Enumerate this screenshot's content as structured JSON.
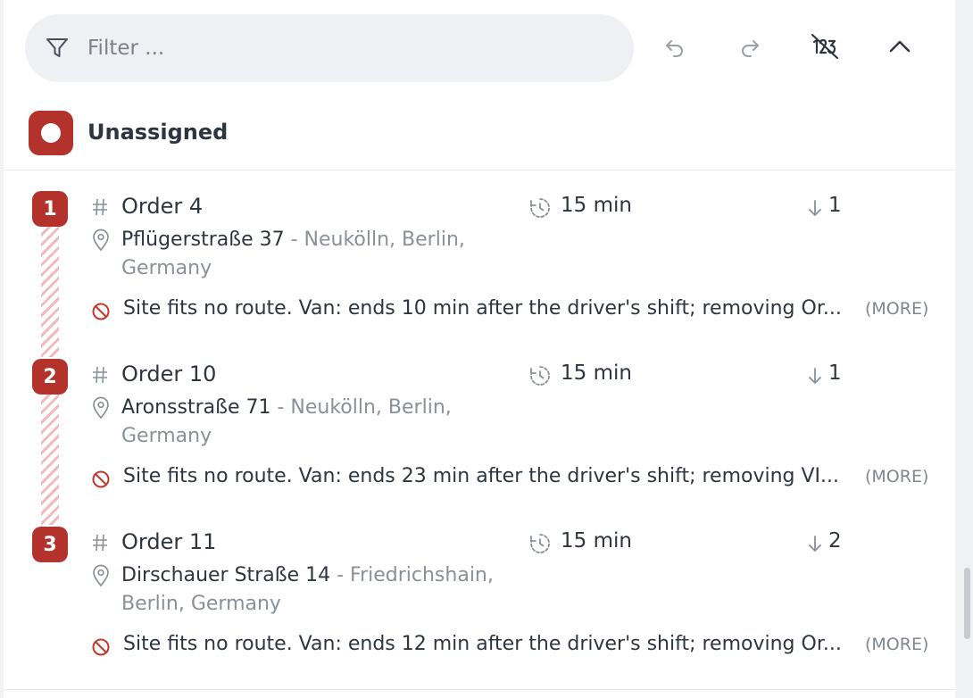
{
  "toolbar": {
    "filter_placeholder": "Filter ...",
    "icons": [
      "filter-icon",
      "undo-icon",
      "redo-icon",
      "numbers-off-icon",
      "chevron-up-icon"
    ]
  },
  "group": {
    "title": "Unassigned",
    "color": "#b3322c"
  },
  "orders": [
    {
      "index": "1",
      "name": "Order 4",
      "duration": "15 min",
      "count": "1",
      "street": "Pflügerstraße 37",
      "area": " - Neukölln, Berlin, Germany",
      "warning": "Site fits no route. Van: ends 10 min after the driver's shift; removing Or...",
      "more": "(MORE)"
    },
    {
      "index": "2",
      "name": "Order 10",
      "duration": "15 min",
      "count": "1",
      "street": "Aronsstraße 71",
      "area": " - Neukölln, Berlin, Germany",
      "warning": "Site fits no route. Van: ends 23 min after the driver's shift; removing VI...",
      "more": "(MORE)"
    },
    {
      "index": "3",
      "name": "Order 11",
      "duration": "15 min",
      "count": "2",
      "street": "Dirschauer Straße 14",
      "area": " - Friedrichshain, Berlin, Germany",
      "warning": "Site fits no route. Van: ends 12 min after the driver's shift; removing Or...",
      "more": "(MORE)"
    }
  ]
}
